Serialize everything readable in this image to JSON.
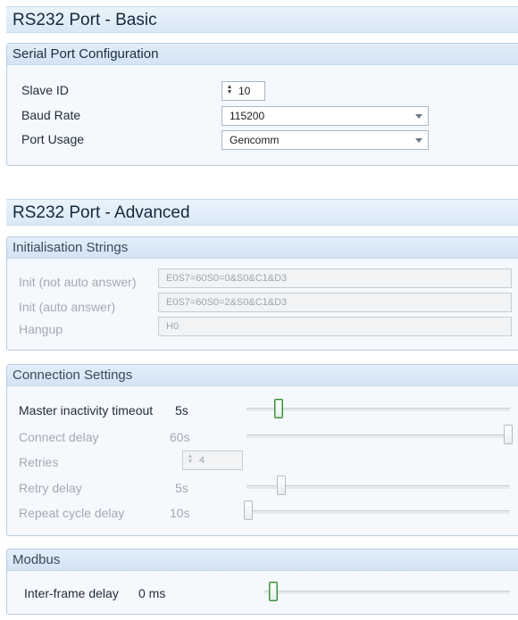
{
  "basic": {
    "title": "RS232 Port - Basic",
    "section_title": "Serial Port Configuration",
    "slave_id_label": "Slave ID",
    "slave_id_value": "10",
    "baud_rate_label": "Baud Rate",
    "baud_rate_value": "115200",
    "port_usage_label": "Port Usage",
    "port_usage_value": "Gencomm"
  },
  "advanced": {
    "title": "RS232 Port - Advanced",
    "init_section": {
      "title": "Initialisation Strings",
      "rows": [
        {
          "label": "Init (not auto answer)",
          "value": "E0S7=60S0=0&S0&C1&D3"
        },
        {
          "label": "Init (auto answer)",
          "value": "E0S7=60S0=2&S0&C1&D3"
        },
        {
          "label": "Hangup",
          "value": "H0"
        }
      ]
    },
    "connection_section": {
      "title": "Connection Settings",
      "master_label": "Master inactivity timeout",
      "master_value": "5s",
      "master_level": 0.07,
      "connect_label": "Connect delay",
      "connect_value": "60s",
      "connect_level": 1.0,
      "retries_label": "Retries",
      "retries_value": "4",
      "retry_delay_label": "Retry delay",
      "retry_delay_value": "5s",
      "retry_delay_level": 0.08,
      "repeat_label": "Repeat cycle delay",
      "repeat_value": "10s",
      "repeat_level": 0.0
    },
    "modbus_section": {
      "title": "Modbus",
      "interframe_label": "Inter-frame delay",
      "interframe_value": "0 ms",
      "interframe_level": 0.0
    }
  }
}
